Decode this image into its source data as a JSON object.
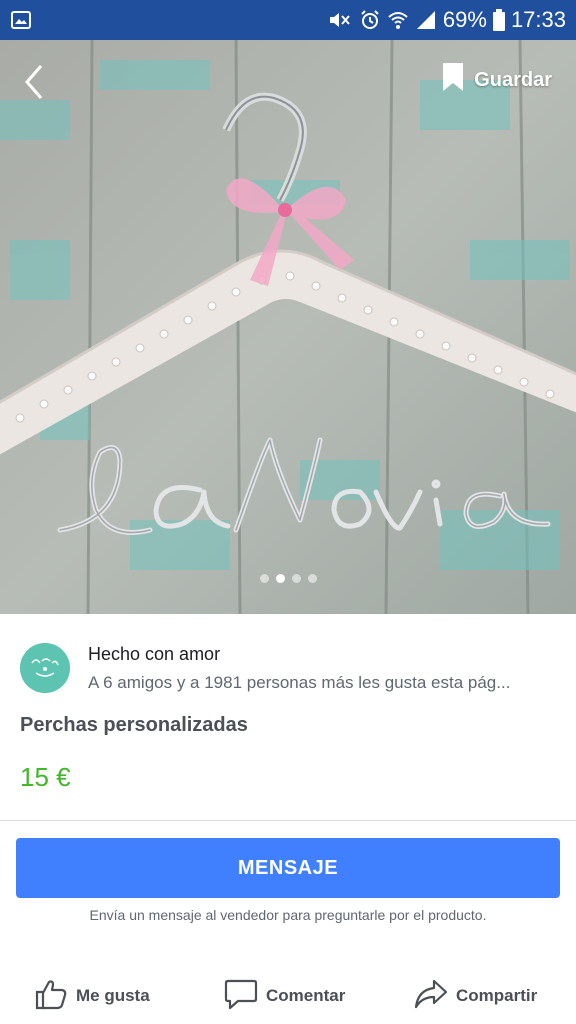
{
  "status_bar": {
    "battery": "69%",
    "time": "17:33",
    "icons": [
      "gallery-icon",
      "mute-icon",
      "alarm-icon",
      "wifi-icon",
      "signal-icon",
      "battery-icon"
    ]
  },
  "header": {
    "back_icon": "chevron-left-icon",
    "save_label": "Guardar",
    "save_icon": "bookmark-icon"
  },
  "gallery": {
    "image_count": 4,
    "active_index": 1,
    "photo_wire_text": "La Novia"
  },
  "seller": {
    "name": "Hecho con amor",
    "likes_text": "A 6 amigos y a 1981 personas más les gusta esta pág...",
    "avatar_color": "#5ec4b2"
  },
  "product": {
    "title": "Perchas personalizadas",
    "price": "15 €",
    "price_color": "#42b72a"
  },
  "message": {
    "button_label": "MENSAJE",
    "button_color": "#4080ff",
    "helper": "Envía un mensaje al vendedor para preguntarle por el producto."
  },
  "actions": {
    "like": "Me gusta",
    "comment": "Comentar",
    "share": "Compartir"
  }
}
